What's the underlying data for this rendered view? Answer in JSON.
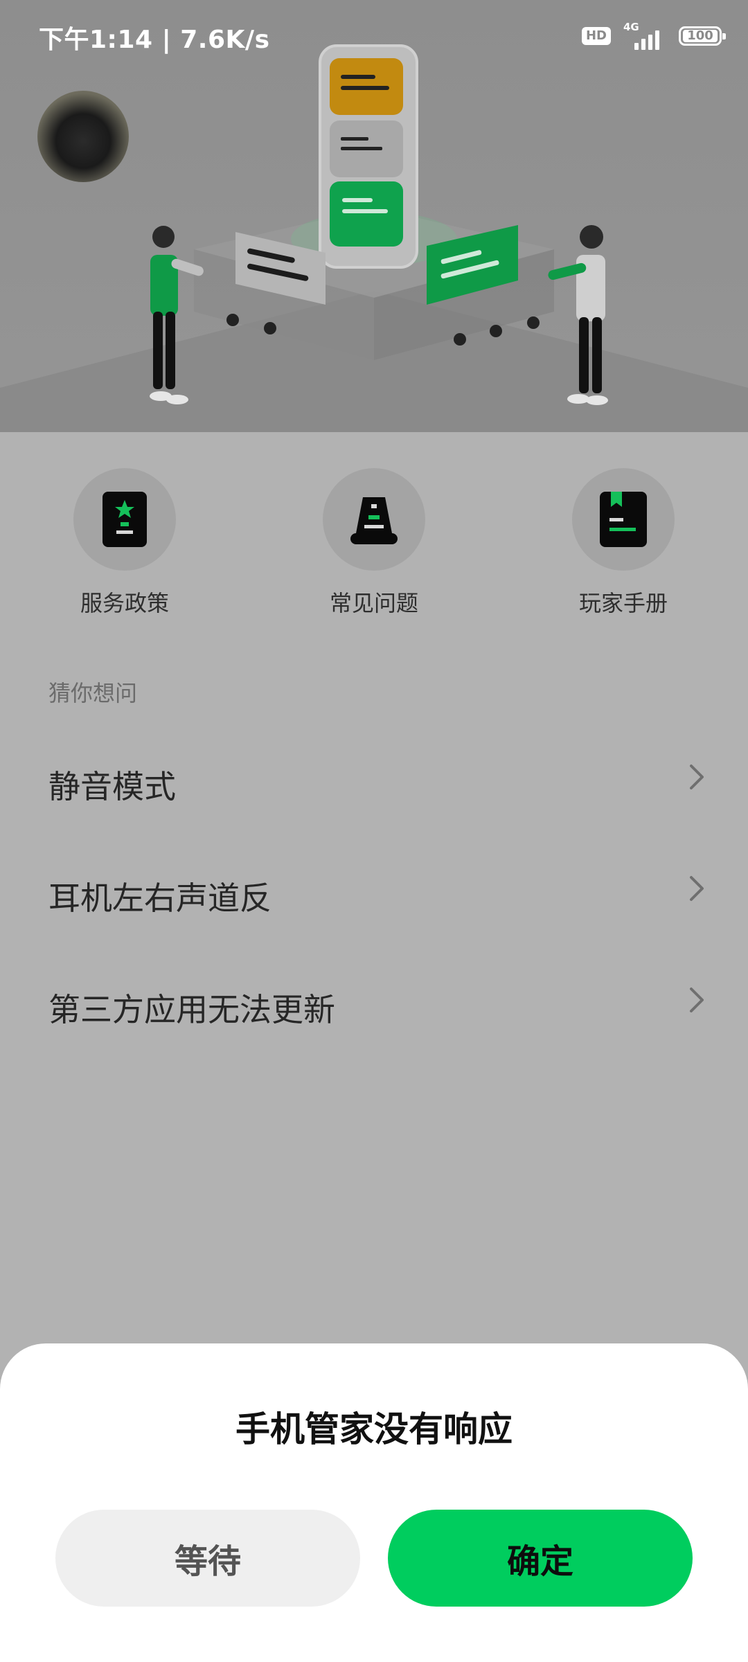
{
  "status_bar": {
    "time_speed": "下午1:14 | 7.6K/s",
    "hd": "HD",
    "network": "4G",
    "battery": "100"
  },
  "hero": {
    "avatar_icon": "user-avatar"
  },
  "quick_links": [
    {
      "label": "服务政策",
      "icon": "policy-document-icon"
    },
    {
      "label": "常见问题",
      "icon": "faq-icon"
    },
    {
      "label": "玩家手册",
      "icon": "player-handbook-icon"
    }
  ],
  "guess": {
    "title": "猜你想问",
    "items": [
      {
        "label": "静音模式"
      },
      {
        "label": "耳机左右声道反"
      },
      {
        "label": "第三方应用无法更新"
      }
    ]
  },
  "dialog": {
    "title": "手机管家没有响应",
    "wait_label": "等待",
    "ok_label": "确定"
  },
  "colors": {
    "accent": "#00cd5e",
    "overlay": "#b2b2b2"
  }
}
